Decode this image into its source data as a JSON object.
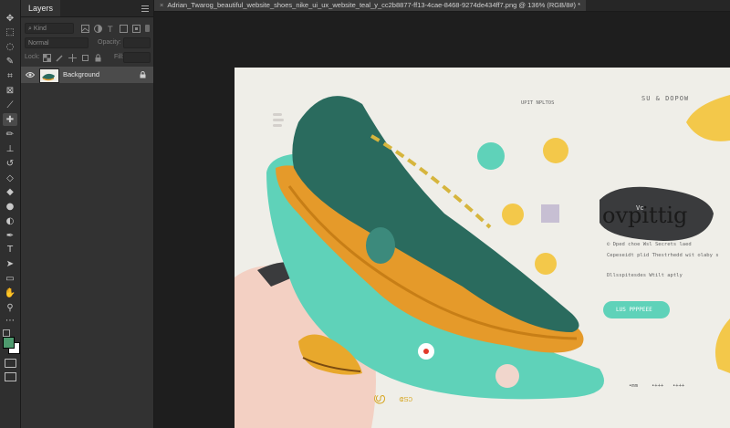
{
  "document": {
    "tab_title": "Adrian_Twarog_beautiful_website_shoes_nike_ui_ux_website_teal_y_cc2b8877-ff13-4cae-8468-9274de434ff7.png @ 136% (RGB/8#) *"
  },
  "layers_panel": {
    "tab_label": "Layers",
    "search_placeholder": "Kind",
    "blend_mode": "Normal",
    "opacity_label": "Opacity:",
    "opacity_value": "",
    "lock_label": "Lock:",
    "fill_label": "Fill:",
    "fill_value": "",
    "layers": [
      {
        "name": "Background",
        "visible": true,
        "locked": true
      }
    ]
  },
  "toolbar": {
    "tools": [
      "move-icon",
      "marquee-icon",
      "lasso-icon",
      "quick-select-icon",
      "crop-icon",
      "frame-icon",
      "eyedropper-icon",
      "healing-icon",
      "brush-icon",
      "clone-stamp-icon",
      "history-brush-icon",
      "eraser-icon",
      "paint-bucket-icon",
      "blur-icon",
      "dodge-icon",
      "pen-icon",
      "type-icon",
      "path-select-icon",
      "rectangle-icon",
      "hand-icon",
      "zoom-icon",
      "more-tools-icon"
    ],
    "foreground_color": "#4e9a6e",
    "background_color": "#ffffff"
  },
  "artwork": {
    "top_right_text": "SU & DOPOW",
    "label_top": "UPIT NPLTOS",
    "headline": "ovpittig",
    "headline_small": "Vc",
    "body_lines": [
      "© Dped choe Wsl Secrets laed",
      "Cepeseidt plid Thestrhedd wit olaby s",
      "Dllsspitesdes Wtilt aptly"
    ],
    "button_label": "LUS PPPPEEE",
    "bottom_script": "ഗ്ര",
    "bottom_script2": "ടോ",
    "footer_items": [
      "•mm",
      "•+++",
      "•+++"
    ],
    "accent_teal": "#5fd2b9",
    "accent_orange": "#e59a2a",
    "accent_yellow": "#f3c84a"
  }
}
